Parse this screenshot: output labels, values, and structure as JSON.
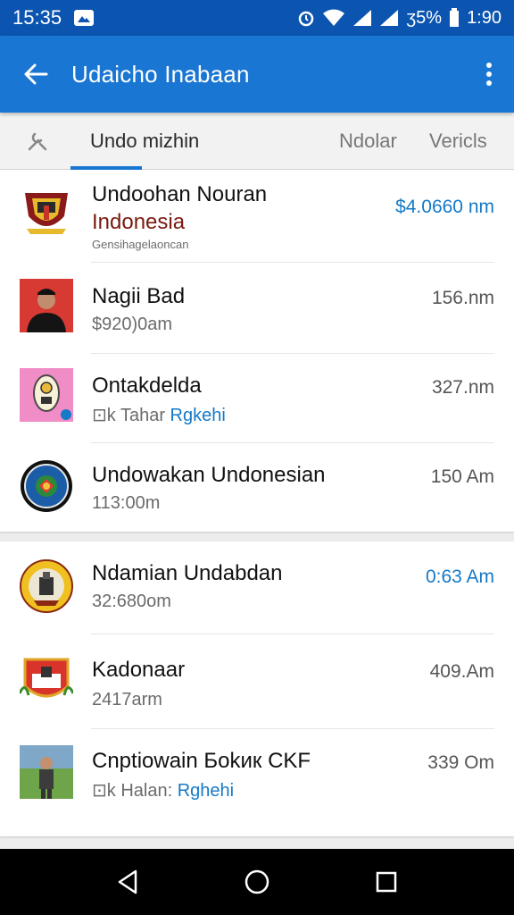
{
  "status_bar": {
    "time": "15:35",
    "battery": "ʒ5%",
    "clock": "1:90"
  },
  "app_bar": {
    "title": "Udaicho Inabaan",
    "back_icon": "arrow-left-icon",
    "more_icon": "more-vert-icon"
  },
  "tabs": [
    {
      "label": "Undo  mizhin",
      "active": true
    },
    {
      "label": "Ndolar",
      "active": false
    },
    {
      "label": "Vericls",
      "active": false
    }
  ],
  "list1": [
    {
      "name": "Undoohan Nouran",
      "line2": "Indonesia",
      "line3": "Gensihagelaoncan",
      "meta": "$4.0660 nm",
      "meta_blue": true,
      "thumb": "garuda-emblem"
    },
    {
      "name": "Nagii Bad",
      "sub": "$920)0am",
      "meta": "156.nm",
      "meta_blue": false,
      "thumb": "person-photo"
    },
    {
      "name": "Ontakdelda",
      "sub_prefix": "⊡k Tahar ",
      "sub_link": "Rgkehi",
      "meta": "327.nm",
      "meta_blue": false,
      "thumb": "pink-badge"
    },
    {
      "name": "Undowakan Undonesian",
      "sub": "113:00m",
      "meta": "150 Am",
      "meta_blue": false,
      "thumb": "round-seal"
    }
  ],
  "list2": [
    {
      "name": "Ndamian  Undabdan",
      "sub": "32:680om",
      "meta": "0:63 Am",
      "meta_blue": true,
      "thumb": "yellow-seal"
    },
    {
      "name": "Kadonaar",
      "sub": "2417arm",
      "meta": "409.Am",
      "meta_blue": false,
      "thumb": "red-crest"
    },
    {
      "name": "Cnptiowain Бokик CKF",
      "sub_prefix": "⊡k Halan: ",
      "sub_link": "Rghehi",
      "meta": "339 Оm",
      "meta_blue": false,
      "thumb": "outdoor-photo"
    }
  ],
  "nav": {
    "back": "triangle-back-icon",
    "home": "circle-home-icon",
    "recents": "square-recents-icon"
  },
  "colors": {
    "status": "#0b55b0",
    "appbar": "#1976d2",
    "accent": "#1479c7"
  }
}
